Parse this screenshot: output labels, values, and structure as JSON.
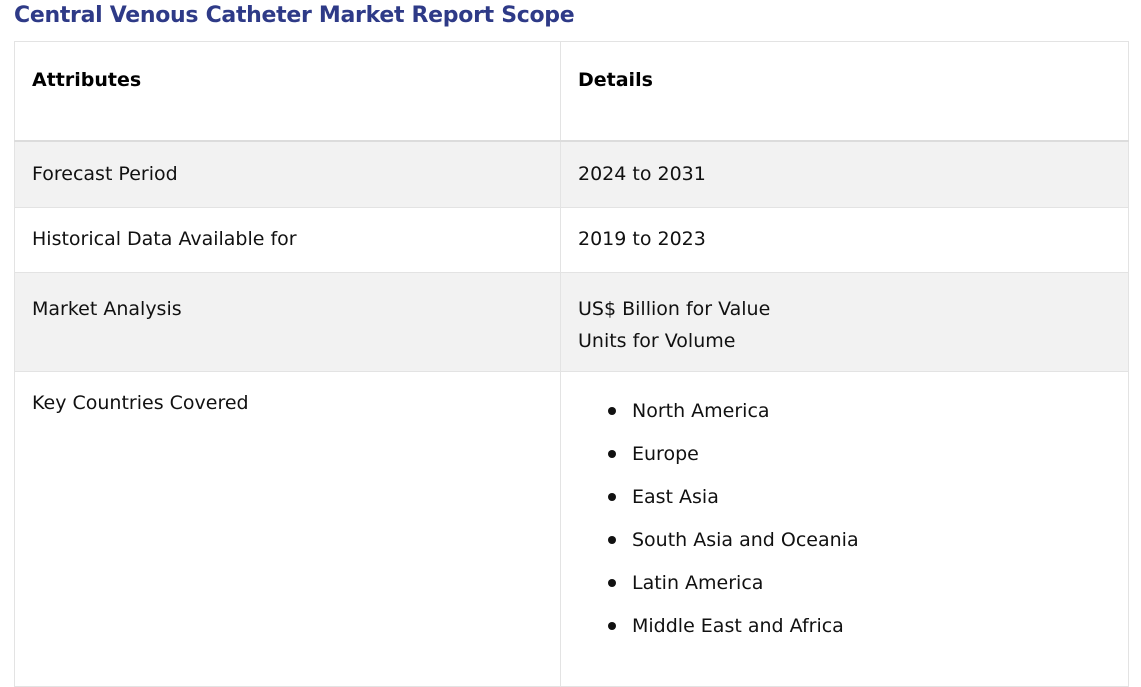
{
  "title": "Central Venous Catheter Market Report Scope",
  "table": {
    "headers": [
      "Attributes",
      "Details"
    ],
    "rows": [
      {
        "attribute": "Forecast Period",
        "details": [
          "2024 to 2031"
        ]
      },
      {
        "attribute": "Historical Data Available for",
        "details": [
          "2019 to 2023"
        ]
      },
      {
        "attribute": "Market Analysis",
        "details": [
          "US$ Billion for Value",
          "Units for Volume"
        ]
      },
      {
        "attribute": "Key Countries Covered",
        "details": [
          "North America",
          "Europe",
          "East Asia",
          "South Asia and Oceania",
          "Latin America",
          "Middle East and Africa"
        ]
      }
    ]
  },
  "colors": {
    "title": "#2e3a87",
    "row_shade": "#f2f2f2",
    "border": "#e3e3e3"
  },
  "icons": {
    "list_bullet": "bullet-icon"
  }
}
